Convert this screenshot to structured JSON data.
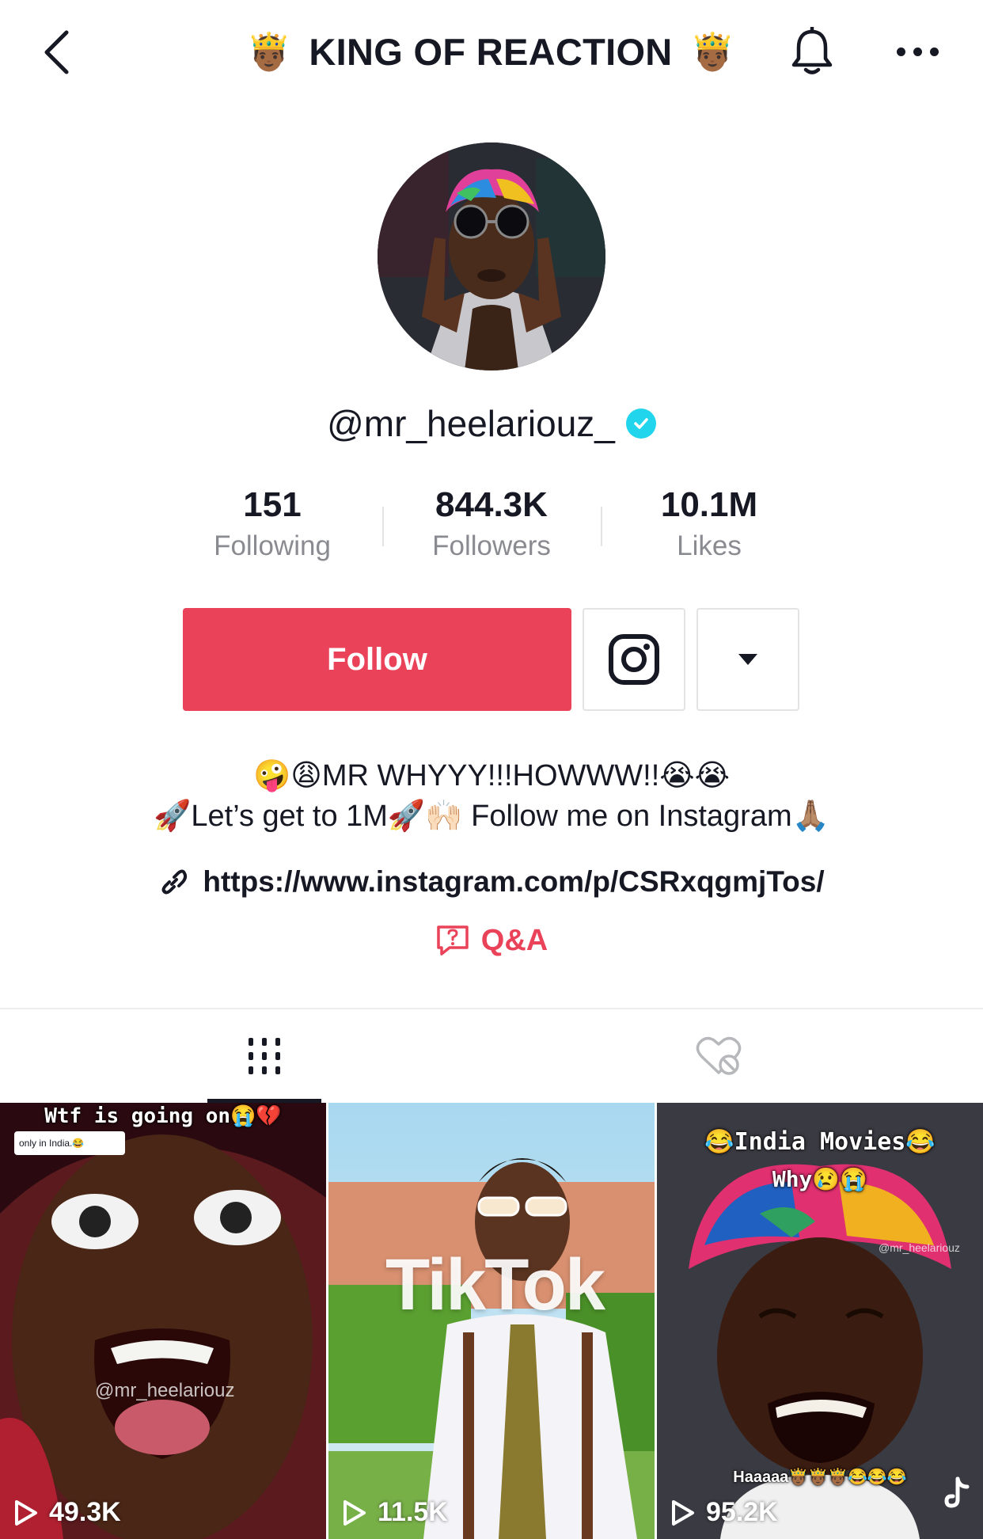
{
  "header": {
    "title": "KING OF REACTION",
    "title_emoji": "🤴🏾"
  },
  "profile": {
    "handle": "@mr_heelariouz_",
    "verified": true
  },
  "stats": [
    {
      "value": "151",
      "label": "Following"
    },
    {
      "value": "844.3K",
      "label": "Followers"
    },
    {
      "value": "10.1M",
      "label": "Likes"
    }
  ],
  "actions": {
    "follow_label": "Follow"
  },
  "bio": {
    "line1": "🤪😩MR WHYYY!!!HOWWW!!😭😭",
    "line2": "🚀Let’s get  to 1M🚀🙌🏻 Follow me on Instagram🙏🏽",
    "link": "https://www.instagram.com/p/CSRxqgmjTos/",
    "qa_label": "Q&A"
  },
  "tabs": [
    "videos",
    "liked"
  ],
  "videos": [
    {
      "caption": "Wtf is going on😭💔",
      "reply_text": "only in India.😂",
      "watermark": "@mr_heelariouz",
      "views": "49.3K"
    },
    {
      "caption": "TikTok",
      "views": "11.5K"
    },
    {
      "caption": "😂India Movies😂",
      "caption2": "Why😢😭",
      "watermark": "@mr_heelariouz",
      "bottom_text": "Haaaaa🤴🏾🤴🏾🤴🏾😂😂😂",
      "views": "95.2K"
    }
  ],
  "colors": {
    "accent": "#ea4359",
    "verified": "#20d5ec",
    "text": "#161823",
    "muted": "#8a8b91"
  }
}
